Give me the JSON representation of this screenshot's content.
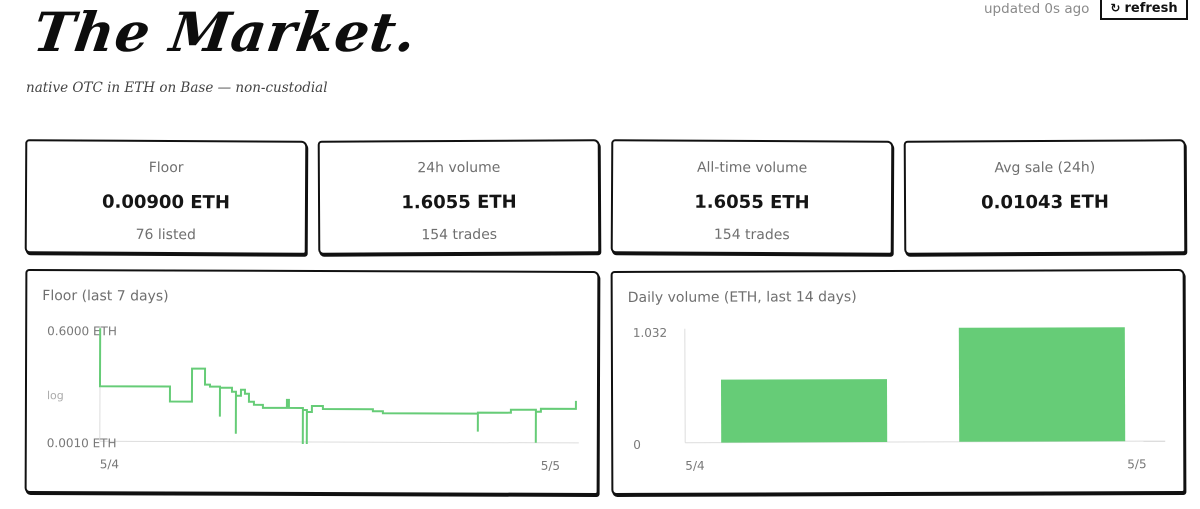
{
  "header": {
    "title": "The Market.",
    "subtitle": "native OTC in ETH on Base — non-custodial",
    "updated": "updated 0s ago",
    "refresh_label": "refresh",
    "refresh_icon": "refresh-icon"
  },
  "stats": [
    {
      "label": "Floor",
      "value": "0.00900 ETH",
      "sub": "76 listed"
    },
    {
      "label": "24h volume",
      "value": "1.6055 ETH",
      "sub": "154 trades"
    },
    {
      "label": "All-time volume",
      "value": "1.6055 ETH",
      "sub": "154 trades"
    },
    {
      "label": "Avg sale (24h)",
      "value": "0.01043 ETH",
      "sub": ""
    }
  ],
  "floor_chart": {
    "title": "Floor (last 7 days)",
    "y_top_label": "0.6000 ETH",
    "y_bottom_label": "0.0010 ETH",
    "y_scale_label": "log",
    "x_labels": [
      "5/4",
      "5/5"
    ],
    "color": "#66cc77"
  },
  "volume_chart": {
    "title": "Daily volume (ETH, last 14 days)",
    "y_top_label": "1.032",
    "y_bottom_label": "0",
    "x_labels": [
      "5/4",
      "5/5"
    ],
    "color": "#66cc77"
  },
  "chart_data": [
    {
      "type": "line",
      "title": "Floor (last 7 days)",
      "scale": "log",
      "ylim": [
        0.001,
        0.6
      ],
      "x": [
        "5/4",
        "5/5"
      ],
      "series": [
        {
          "values": [
            0.6,
            0.025,
            0.025,
            0.012,
            0.012,
            0.03,
            0.03,
            0.02,
            0.02,
            0.017,
            0.012,
            0.01,
            0.0095,
            0.009,
            0.008,
            0.008,
            0.0075,
            0.0075,
            0.008,
            0.009,
            0.009,
            0.01
          ]
        }
      ]
    },
    {
      "type": "bar",
      "title": "Daily volume (ETH, last 14 days)",
      "categories": [
        "5/4",
        "5/5"
      ],
      "values": [
        0.57,
        1.032
      ],
      "ylim": [
        0,
        1.032
      ]
    }
  ]
}
